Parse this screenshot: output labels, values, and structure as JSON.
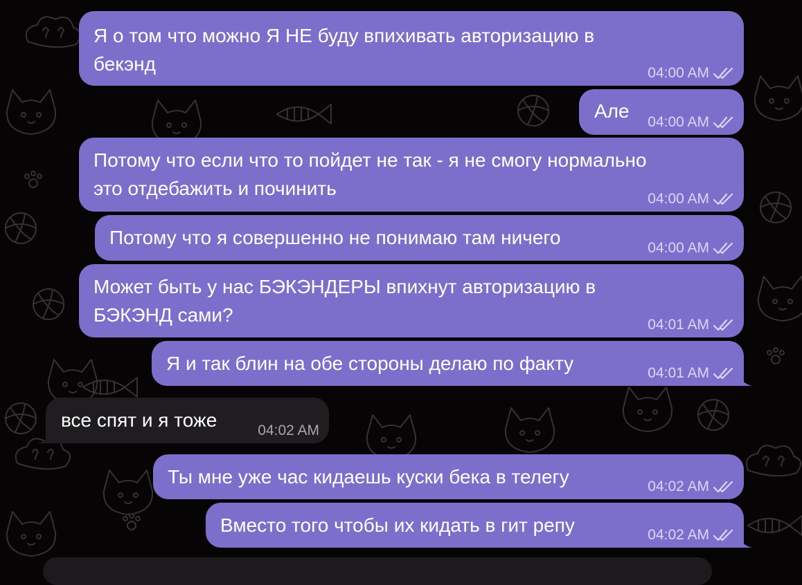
{
  "colors": {
    "background": "#060405",
    "outgoing_bubble": "#7c6fcb",
    "incoming_bubble": "#1f1d1f",
    "doodle_stroke": "#3a3034"
  },
  "wallpaper": {
    "icon": "cat-doodle-pattern"
  },
  "messages": [
    {
      "direction": "outgoing",
      "lines": [
        "Я о том что можно Я НЕ буду впихивать авторизацию в",
        "бекэнд"
      ],
      "time": "04:00 AM",
      "status": "read-double-check-icon"
    },
    {
      "direction": "outgoing",
      "lines": [
        "Але"
      ],
      "time": "04:00 AM",
      "status": "read-double-check-icon"
    },
    {
      "direction": "outgoing",
      "lines": [
        "Потому что если что то пойдет не так - я не смогу нормально",
        "это отдебажить и починить"
      ],
      "time": "04:00 AM",
      "status": "read-double-check-icon"
    },
    {
      "direction": "outgoing",
      "lines": [
        "Потому что я совершенно не понимаю там ничего"
      ],
      "time": "04:00 AM",
      "status": "read-double-check-icon"
    },
    {
      "direction": "outgoing",
      "lines": [
        "Может быть у нас БЭКЭНДЕРЫ впихнут авторизацию в",
        "БЭКЭНД сами?"
      ],
      "time": "04:01 AM",
      "status": "read-double-check-icon"
    },
    {
      "direction": "outgoing",
      "lines": [
        "Я и так блин на обе стороны делаю по факту"
      ],
      "time": "04:01 AM",
      "status": "read-double-check-icon"
    },
    {
      "direction": "incoming",
      "lines": [
        "все спят и я тоже"
      ],
      "time": "04:02 AM"
    },
    {
      "direction": "outgoing",
      "lines": [
        "Ты мне уже час кидаешь куски бека в телегу"
      ],
      "time": "04:02 AM",
      "status": "read-double-check-icon"
    },
    {
      "direction": "outgoing",
      "lines": [
        "Вместо того чтобы их кидать в гит репу"
      ],
      "time": "04:02 AM",
      "status": "read-double-check-icon"
    }
  ]
}
